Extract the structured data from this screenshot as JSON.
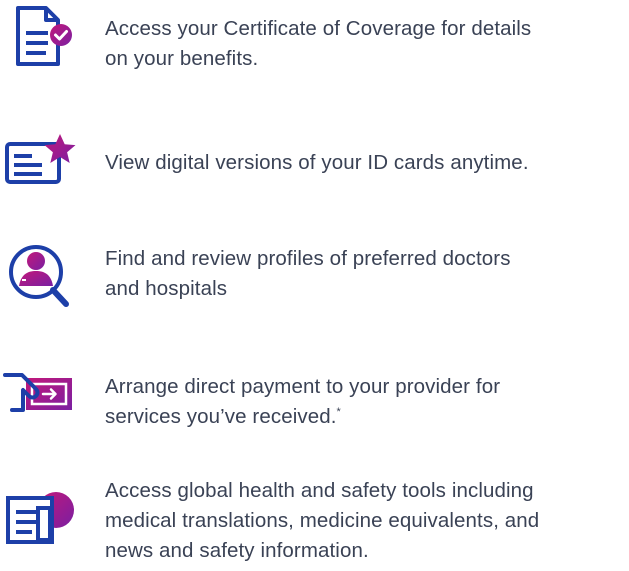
{
  "colors": {
    "text": "#3a4255",
    "navy": "#1d3fa8",
    "magenta": "#c2187a",
    "purple": "#7a1fa2"
  },
  "features": [
    {
      "icon": "certificate-check-icon",
      "lines": [
        "Access your Certificate of Coverage for details",
        "on your benefits."
      ]
    },
    {
      "icon": "id-card-star-icon",
      "lines": [
        "View digital versions of your ID cards anytime."
      ]
    },
    {
      "icon": "doctor-search-icon",
      "lines": [
        "Find and review profiles of preferred doctors",
        "and hospitals"
      ]
    },
    {
      "icon": "payment-hand-icon",
      "lines": [
        "Arrange direct payment to your provider for",
        "services you’ve received."
      ],
      "footnote_mark": "*"
    },
    {
      "icon": "global-health-tools-icon",
      "lines": [
        "Access global health and safety tools including",
        "medical translations, medicine equivalents, and",
        "news and safety information."
      ]
    }
  ]
}
